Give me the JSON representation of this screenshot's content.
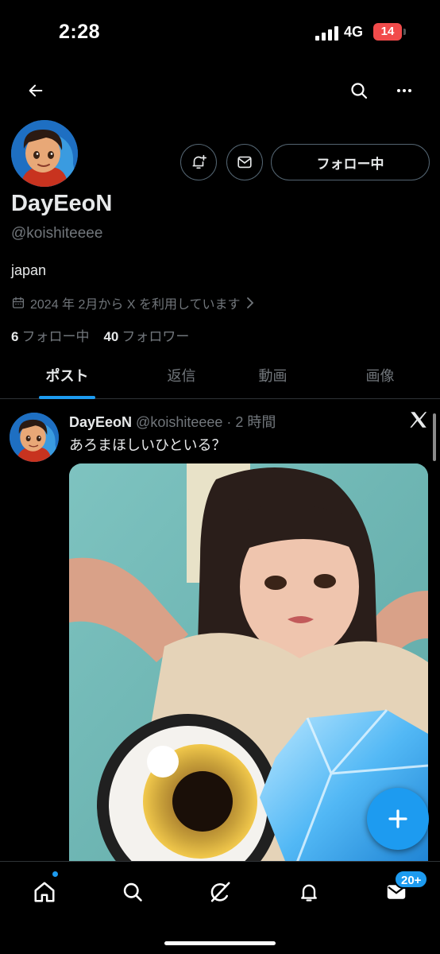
{
  "status_bar": {
    "time": "2:28",
    "network": "4G",
    "battery": "14"
  },
  "header": {
    "back_icon": "arrow-left-icon",
    "search_icon": "search-icon",
    "more_icon": "more-horizontal-icon"
  },
  "profile": {
    "display_name": "DayEeoN",
    "handle": "@koishiteeee",
    "bio": "japan",
    "joined": "2024 年 2月から X を利用しています",
    "following_count": "6",
    "following_label": "フォロー中",
    "followers_count": "40",
    "followers_label": "フォロワー",
    "follow_button_label": "フォロー中"
  },
  "tabs": [
    {
      "label": "ポスト",
      "active": true
    },
    {
      "label": "返信",
      "active": false
    },
    {
      "label": "動画",
      "active": false
    },
    {
      "label": "画像",
      "active": false
    }
  ],
  "post": {
    "author_name": "DayEeoN",
    "meta": "@koishiteeee · 2 時間",
    "text": "あろまほしいひといる？"
  },
  "bottom_nav": {
    "items": [
      "home-icon",
      "search-icon",
      "grok-icon",
      "notifications-icon",
      "messages-icon"
    ],
    "mail_badge": "20+"
  },
  "colors": {
    "accent": "#1d9bf0",
    "background": "#000000",
    "text_primary": "#e7e9ea",
    "text_secondary": "#71767b",
    "battery": "#f14b4b"
  }
}
